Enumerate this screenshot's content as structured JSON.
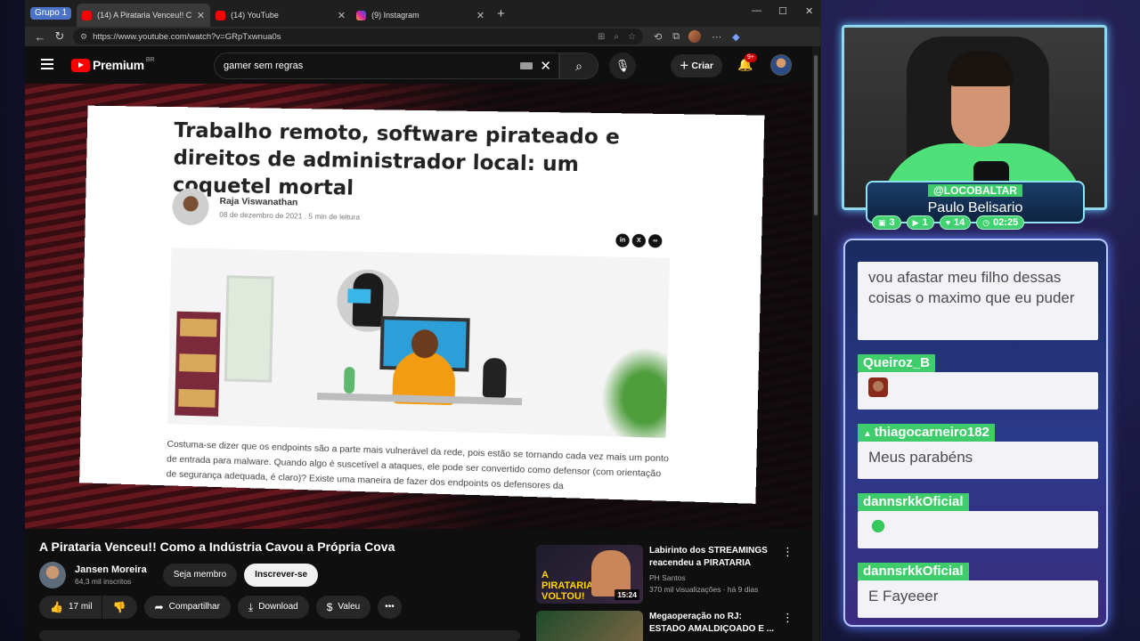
{
  "browser": {
    "group_label": "Grupo 1",
    "tabs": [
      {
        "title": "(14) A Pirataria Venceu!! Como a Ind",
        "active": true
      },
      {
        "title": "(14) YouTube",
        "active": false
      },
      {
        "title": "(9) Instagram",
        "active": false
      }
    ],
    "url": "https://www.youtube.com/watch?v=GRpTxwnua0s"
  },
  "youtube": {
    "logo_text": "Premium",
    "logo_region": "BR",
    "search_query": "gamer sem regras",
    "create_label": "Criar",
    "notification_count": "9+"
  },
  "article": {
    "title": "Trabalho remoto, software pirateado e direitos de administrador local: um coquetel mortal",
    "author": "Raja Viswanathan",
    "meta": "08 de dezembro de 2021 . 5 min de leitura",
    "body": "Costuma-se dizer que os endpoints são a parte mais vulnerável da rede, pois estão se tornando cada vez mais um ponto de entrada para malware. Quando algo é suscetível a ataques, ele pode ser convertido como defensor (com orientação de segurança adequada, é claro)? Existe uma maneira de fazer dos endpoints os defensores da"
  },
  "video": {
    "title": "A Pirataria Venceu!! Como a Indústria Cavou a Própria Cova",
    "channel": "Jansen Moreira",
    "subscribers": "64,3 mil inscritos",
    "member_label": "Seja membro",
    "subscribe_label": "Inscrever-se",
    "likes": "17 mil",
    "share_label": "Compartilhar",
    "download_label": "Download",
    "thanks_label": "Valeu"
  },
  "recommendations": [
    {
      "title": "Labirinto dos STREAMINGS reacendeu a PIRATARIA",
      "channel": "PH Santos",
      "meta": "370 mil visualizações · há 9 dias",
      "duration": "15:24",
      "thumb_text": "A PIRATARIA VOLTOU!"
    },
    {
      "title": "Megaoperação no RJ: ESTADO AMALDIÇOADO E ...",
      "channel": "",
      "meta": "",
      "duration": ""
    }
  ],
  "streamer": {
    "handle": "@LOCOBALTAR",
    "name": "Paulo Belisario",
    "stats": [
      {
        "icon": "chat-icon",
        "value": "3"
      },
      {
        "icon": "video-icon",
        "value": "1"
      },
      {
        "icon": "heart-icon",
        "value": "14"
      },
      {
        "icon": "clock-icon",
        "value": "02:25"
      }
    ]
  },
  "chat": [
    {
      "user": "",
      "text": "vou afastar meu filho dessas coisas o maximo que eu puder"
    },
    {
      "user": "Queiroz_B",
      "text": ""
    },
    {
      "user": "thiagocarneiro182",
      "text": "Meus parabéns"
    },
    {
      "user": "dannsrkkOficial",
      "text": ""
    },
    {
      "user": "dannsrkkOficial",
      "text": "E Fayeeer"
    }
  ]
}
